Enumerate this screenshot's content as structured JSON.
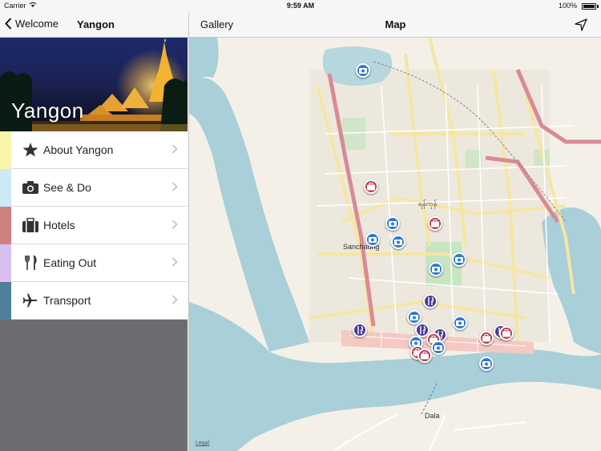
{
  "status_bar": {
    "carrier": "Carrier",
    "time": "9:59 AM",
    "battery": "100%"
  },
  "left_nav": {
    "back_label": "Welcome",
    "title": "Yangon"
  },
  "hero": {
    "title": "Yangon"
  },
  "menu": [
    {
      "label": "About Yangon",
      "icon": "star-icon",
      "color": "#f8f4a8"
    },
    {
      "label": "See & Do",
      "icon": "camera-icon",
      "color": "#cde9f6"
    },
    {
      "label": "Hotels",
      "icon": "suitcase-icon",
      "color": "#cf7f80"
    },
    {
      "label": "Eating Out",
      "icon": "fork-knife-icon",
      "color": "#d9bff0"
    },
    {
      "label": "Transport",
      "icon": "airplane-icon",
      "color": "#4f7f9a"
    }
  ],
  "right_nav": {
    "gallery_label": "Gallery",
    "title": "Map",
    "locate_icon": "location-arrow-icon"
  },
  "map": {
    "labels": {
      "sanchaung": "Sanchaung",
      "dala": "Dala",
      "mingalar": "ရန်ကုန်"
    },
    "legal": "Legal",
    "pin_colors": {
      "see_do": "#2e7ad1",
      "hotel": "#c0394b",
      "eating_out": "#4b3c95"
    }
  }
}
